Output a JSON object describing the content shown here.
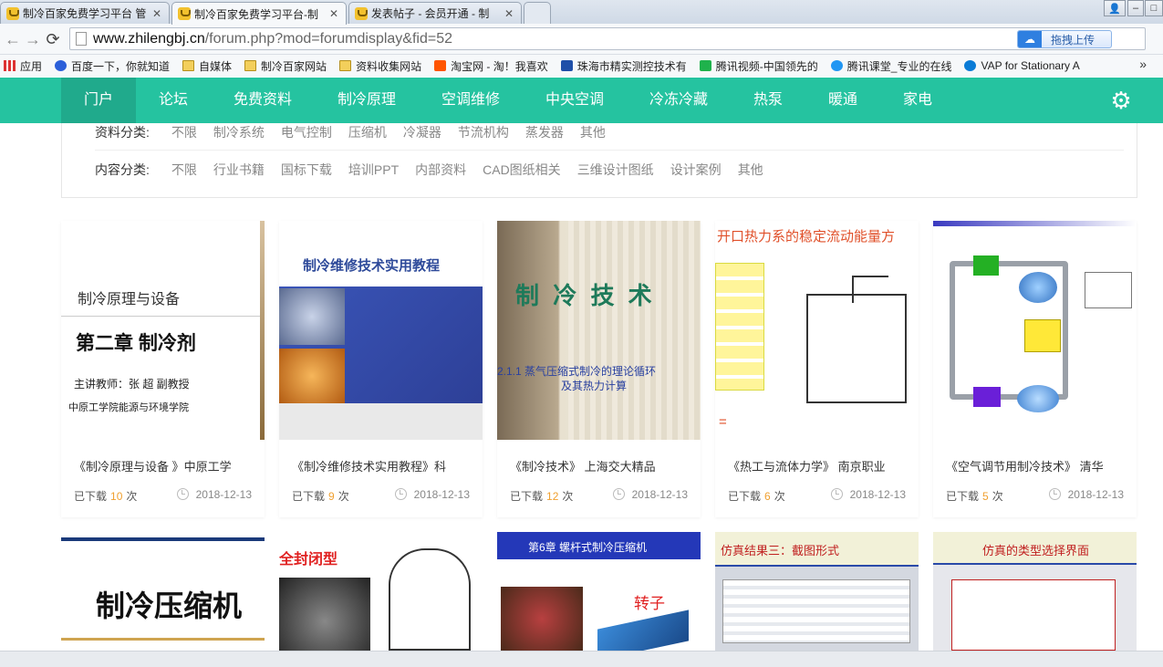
{
  "browser": {
    "tabs": [
      {
        "title": "制冷百家免费学习平台 管"
      },
      {
        "title": "制冷百家免费学习平台-制"
      },
      {
        "title": "发表帖子 - 会员开通 - 制"
      }
    ],
    "url_host": "www.zhilengbj.cn",
    "url_path": "/forum.php?mod=forumdisplay&fid=52",
    "upload_label": "拖拽上传",
    "bookmarks": [
      {
        "label": "应用",
        "icon": "apps-icon"
      },
      {
        "label": "百度一下，你就知道",
        "icon": "baidu-icon"
      },
      {
        "label": "自媒体",
        "icon": "folder-icon"
      },
      {
        "label": "制冷百家网站",
        "icon": "folder-icon"
      },
      {
        "label": "资料收集网站",
        "icon": "folder-icon"
      },
      {
        "label": "淘宝网 - 淘！我喜欢",
        "icon": "taobao-icon"
      },
      {
        "label": "珠海市精实测控技术有",
        "icon": "star-icon"
      },
      {
        "label": "腾讯视频-中国领先的",
        "icon": "tencent-video-icon"
      },
      {
        "label": "腾讯课堂_专业的在线",
        "icon": "tencent-class-icon"
      },
      {
        "label": "VAP for Stationary A",
        "icon": "vap-icon"
      }
    ],
    "bookmarks_more": "»"
  },
  "nav": {
    "items": [
      "门户",
      "论坛",
      "免费资料",
      "制冷原理",
      "空调维修",
      "中央空调",
      "冷冻冷藏",
      "热泵",
      "暖通",
      "家电"
    ],
    "active_index": 0,
    "accent": "#25c3a0"
  },
  "filters": {
    "category_label": "资料分类:",
    "categories": [
      "不限",
      "制冷系统",
      "电气控制",
      "压缩机",
      "冷凝器",
      "节流机构",
      "蒸发器",
      "其他"
    ],
    "content_label": "内容分类:",
    "contents": [
      "不限",
      "行业书籍",
      "国标下载",
      "培训PPT",
      "内部资料",
      "CAD图纸相关",
      "三维设计图纸",
      "设计案例",
      "其他"
    ]
  },
  "cards": [
    {
      "title": "《制冷原理与设备 》中原工学",
      "downloaded_label": "已下载",
      "count": "10",
      "unit": "次",
      "date": "2018-12-13",
      "thumb": {
        "line1": "制冷原理与设备",
        "line2": "第二章 制冷剂",
        "line3": "主讲教师：张 超 副教授",
        "line4": "中原工学院能源与环境学院"
      }
    },
    {
      "title": "《制冷维修技术实用教程》科",
      "downloaded_label": "已下载",
      "count": "9",
      "unit": "次",
      "date": "2018-12-13",
      "thumb": {
        "line1": "制冷维修技术实用教程"
      }
    },
    {
      "title": "《制冷技术》 上海交大精品",
      "downloaded_label": "已下载",
      "count": "12",
      "unit": "次",
      "date": "2018-12-13",
      "thumb": {
        "line1": "制 冷 技 术",
        "line2": "2.1.1 蒸气压缩式制冷的理论循环",
        "line3": "及其热力计算"
      }
    },
    {
      "title": "《热工与流体力学》 南京职业",
      "downloaded_label": "已下载",
      "count": "6",
      "unit": "次",
      "date": "2018-12-13",
      "thumb": {
        "line1": "开口热力系的稳定流动能量方",
        "line2": "="
      }
    },
    {
      "title": "《空气调节用制冷技术》 清华",
      "downloaded_label": "已下载",
      "count": "5",
      "unit": "次",
      "date": "2018-12-13",
      "thumb": {}
    }
  ],
  "cards_row2": [
    {
      "thumb_text": "制冷压缩机"
    },
    {
      "thumb_text": "全封闭型"
    },
    {
      "thumb_text": "第6章 螺杆式制冷压缩机",
      "thumb_text2": "转子"
    },
    {
      "thumb_text": "仿真结果三：截图形式"
    },
    {
      "thumb_text": "仿真的类型选择界面"
    }
  ]
}
